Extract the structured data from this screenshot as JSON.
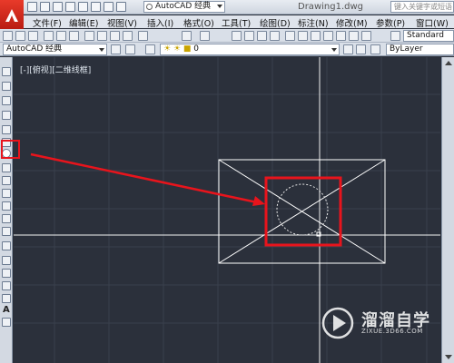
{
  "title_bar": {
    "workspace": "AutoCAD 经典",
    "document_title": "Drawing1.dwg",
    "search_placeholder": "键入关键字或短语"
  },
  "menu": {
    "items": [
      "文件(F)",
      "编辑(E)",
      "视图(V)",
      "插入(I)",
      "格式(O)",
      "工具(T)",
      "绘图(D)",
      "标注(N)",
      "修改(M)",
      "参数(P)",
      "窗口(W)"
    ]
  },
  "toolbar2": {
    "workspace_select": "AutoCAD 经典",
    "layer_select": "0",
    "linetype_select": "ByLayer",
    "style_select": "Standard"
  },
  "canvas": {
    "viewport_label": "[-][俯视][二维线框]"
  },
  "watermark": {
    "name": "溜溜自学",
    "url": "ZIXUE.3D66.COM"
  },
  "colors": {
    "highlight": "#e8141c",
    "canvas_bg": "#2b303b",
    "drawing_lines": "#ffffff"
  },
  "icons": [
    "line-icon",
    "polyline-icon",
    "polygon-icon",
    "rectangle-icon",
    "arc-icon",
    "circle-icon",
    "spline-icon",
    "ellipse-icon",
    "insert-block-icon",
    "point-icon",
    "hatch-icon",
    "table-icon",
    "text-icon"
  ]
}
